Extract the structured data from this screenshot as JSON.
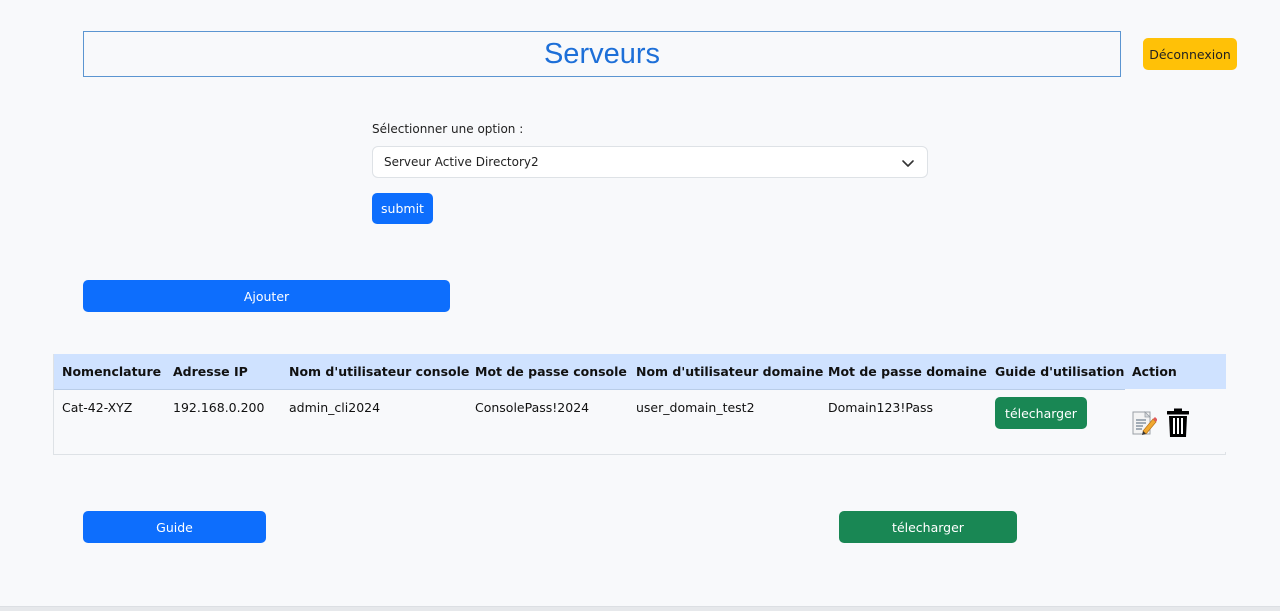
{
  "header": {
    "title": "Serveurs",
    "logout_label": "Déconnexion"
  },
  "form": {
    "select_label": "Sélectionner une option :",
    "selected_option": "Serveur Active Directory2",
    "submit_label": "submit"
  },
  "actions": {
    "add_label": "Ajouter"
  },
  "table": {
    "headers": [
      "Nomenclature",
      "Adresse IP",
      "Nom d'utilisateur console",
      "Mot de passe console",
      "Nom d'utilisateur domaine",
      "Mot de passe domaine",
      "Guide d'utilisation",
      "Action"
    ],
    "rows": [
      {
        "nomenclature": "Cat-42-XYZ",
        "ip": "192.168.0.200",
        "console_user": "admin_cli2024",
        "console_pass": "ConsolePass!2024",
        "domain_user": "user_domain_test2",
        "domain_pass": "Domain123!Pass",
        "guide_button": "télecharger",
        "action_icons": [
          "edit-icon",
          "trash-icon"
        ]
      }
    ]
  },
  "footer": {
    "guide_label": "Guide",
    "download_label": "télecharger"
  },
  "colors": {
    "primary": "#0d6efd",
    "success": "#198754",
    "warning": "#ffc107",
    "title": "#1d6fd8",
    "table_header": "#cfe2ff"
  }
}
